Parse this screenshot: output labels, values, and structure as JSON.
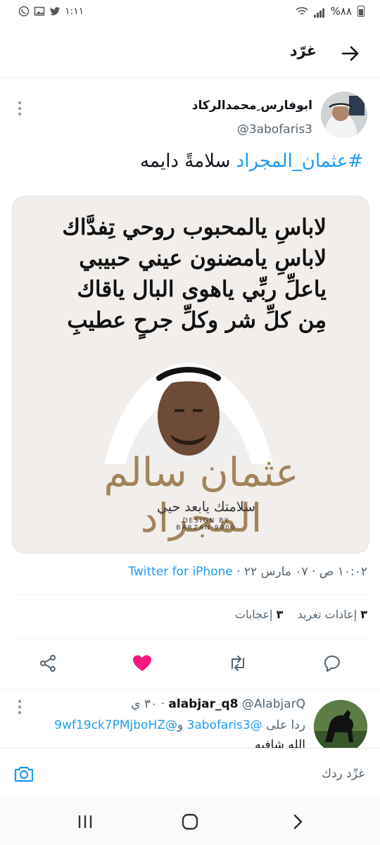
{
  "status_bar": {
    "time": "١:١١",
    "battery": "%٨٨",
    "icons": [
      "whatsapp-icon",
      "gallery-icon",
      "twitter-icon",
      "wifi-icon",
      "signal-icon",
      "battery-icon"
    ]
  },
  "header": {
    "title": "غرّد",
    "back_icon": "arrow-right-icon"
  },
  "tweet": {
    "display_name": "ابوفارس ِمحمدالركاد",
    "handle": "@3abofaris3",
    "hashtag": "#عثمان_المجراد",
    "text": " سلامةً دايمه",
    "media": {
      "poem": [
        "لاباسِ يالمحبوب روحي تِفدَّاك",
        "لاباسِ يامضنون عيني حبيبي",
        "ياعلِّ ربِّي ياهوى البال ياقاك",
        "مِن كلِّ شر وكلِّ جرحٍ عطيبِ"
      ],
      "signature": "عثمان سالم المجراد",
      "subtitle": "سلامتك يابعد حيي",
      "design_credit_1": "DESIGN BY",
      "design_credit_2": "BARZAN 9000"
    },
    "time": "١٠:٠٢ ص",
    "date": "٠٧ مارس ٢٢",
    "source": "Twitter for iPhone",
    "retweets_count": "٣",
    "retweets_label": "إعادات تغريد",
    "likes_count": "٣",
    "likes_label": "إعجابات",
    "like_color": "#f91880"
  },
  "reply": {
    "display_name": "alabjar_q8",
    "handle": "@AlabjarQ",
    "time": "٣٠ ي",
    "replying_prefix": "ردا على",
    "replying_to_1": "@3abofaris3",
    "replying_and": "و",
    "replying_to_2": "@9wf19ck7PMjboHZ",
    "text": "الله شافيه"
  },
  "compose": {
    "placeholder": "غرِّد ردك"
  },
  "nav": {
    "recent_icon": "recent-apps-icon",
    "home_icon": "home-icon",
    "back_icon": "back-icon"
  },
  "colors": {
    "accent": "#1d9bf0",
    "like": "#f91880",
    "muted": "#536471"
  }
}
